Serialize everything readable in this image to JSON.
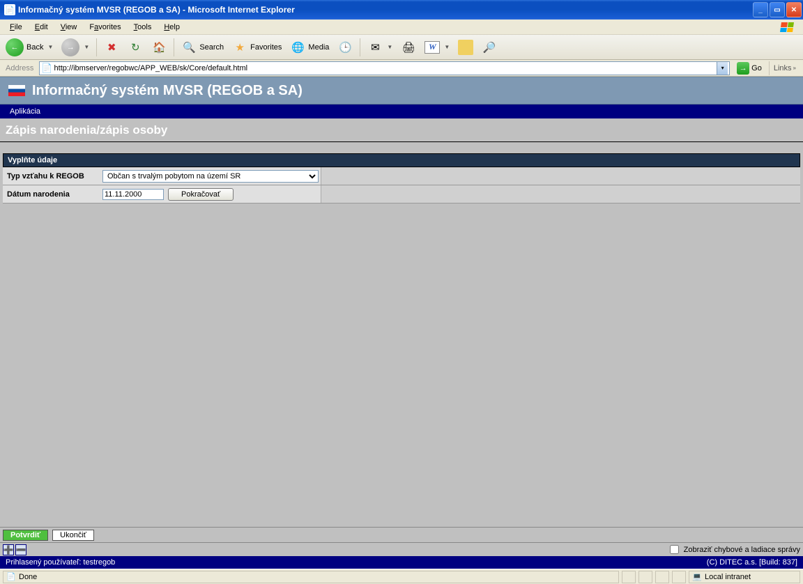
{
  "window": {
    "title": "Informačný systém MVSR (REGOB a SA) - Microsoft Internet Explorer"
  },
  "menubar": {
    "file": "File",
    "edit": "Edit",
    "view": "View",
    "favorites": "Favorites",
    "tools": "Tools",
    "help": "Help"
  },
  "toolbar": {
    "back": "Back",
    "search": "Search",
    "favorites": "Favorites",
    "media": "Media"
  },
  "addressbar": {
    "label": "Address",
    "url": "http://ibmserver/regobwc/APP_WEB/sk/Core/default.html",
    "go": "Go",
    "links": "Links"
  },
  "app": {
    "title": "Informačný systém MVSR (REGOB a SA)",
    "menu_aplikacia": "Aplikácia",
    "page_title": "Zápis narodenia/zápis osoby"
  },
  "form": {
    "section_header": "Vyplňte údaje",
    "row1_label": "Typ vzťahu k REGOB",
    "row1_value": "Občan s trvalým pobytom na území SR",
    "row2_label": "Dátum narodenia",
    "row2_value": "11.11.2000",
    "continue_btn": "Pokračovať"
  },
  "bottom": {
    "potvrdit": "Potvrdiť",
    "ukoncit": "Ukončiť",
    "debug_label": "Zobraziť chybové a ladiace správy"
  },
  "status": {
    "login_text": "Prihlasený používateľ: testregob",
    "build_text": "(C) DITEC a.s. [Build: 837]",
    "ie_done": "Done",
    "ie_zone": "Local intranet"
  }
}
